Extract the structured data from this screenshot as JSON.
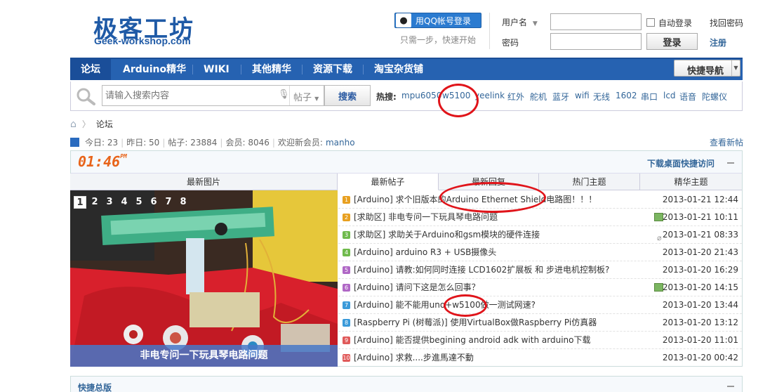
{
  "header": {
    "logo_cn": "极客工坊",
    "logo_en": "Geek-workshop.com",
    "qq_login": "用QQ帐号登录",
    "qq_tip": "只需一步，快速开始",
    "username_label": "用户名",
    "password_label": "密码",
    "auto_login": "自动登录",
    "login_button": "登录",
    "find_password": "找回密码",
    "register": "注册"
  },
  "nav": {
    "items": [
      "论坛",
      "Arduino精华",
      "WIKI",
      "其他精华",
      "资源下载",
      "淘宝杂货铺"
    ],
    "quick_nav": "快捷导航"
  },
  "search": {
    "placeholder": "请输入搜索内容",
    "type": "帖子",
    "button": "搜索",
    "hot_label": "热搜:",
    "hot_words": [
      "mpu6050",
      "w5100",
      "yeelink",
      "红外",
      "舵机",
      "蓝牙",
      "wifi",
      "无线",
      "1602",
      "串口",
      "lcd",
      "语音",
      "陀螺仪"
    ]
  },
  "breadcrumb": {
    "current": "论坛"
  },
  "stats": {
    "today": "今日: 23",
    "yesterday": "昨日: 50",
    "posts": "帖子: 23884",
    "members": "会员: 8046",
    "welcome_label": "欢迎新会员:",
    "new_member": "manho",
    "view_new": "查看新帖"
  },
  "panel": {
    "clock": "01:46",
    "clock_suffix": "PM",
    "download_link": "下载桌面快捷访问",
    "tabs": [
      "最新图片",
      "最新帖子",
      "最新回复",
      "热门主题",
      "精华主题"
    ],
    "pager": [
      "1",
      "2",
      "3",
      "4",
      "5",
      "6",
      "7",
      "8"
    ],
    "photo_caption": "非电专问一下玩具琴电路问题"
  },
  "posts": [
    {
      "num": "1",
      "title": "[Arduino] 求个旧版本的Arduino Ethernet Shield电路图！！！",
      "date": "2013-01-21 12:44",
      "icon": ""
    },
    {
      "num": "2",
      "title": "[求助区] 非电专问一下玩具琴电路问题",
      "date": "2013-01-21 10:11",
      "icon": "image-icon"
    },
    {
      "num": "3",
      "title": "[求助区] 求助关于Arduino和gsm模块的硬件连接",
      "date": "2013-01-21 08:33",
      "icon": "attachment-icon"
    },
    {
      "num": "4",
      "title": "[Arduino] arduino R3 + USB摄像头",
      "date": "2013-01-20 21:43",
      "icon": ""
    },
    {
      "num": "5",
      "title": "[Arduino] 请教:如何同时连接 LCD1602扩展板 和 步进电机控制板?",
      "date": "2013-01-20 16:29",
      "icon": ""
    },
    {
      "num": "6",
      "title": "[Arduino] 请问下这是怎么回事？",
      "date": "2013-01-20 14:15",
      "icon": "image-icon"
    },
    {
      "num": "7",
      "title": "[Arduino] 能不能用uno+w5100做一测试网速?",
      "date": "2013-01-20 13:44",
      "icon": ""
    },
    {
      "num": "8",
      "title": "[Raspberry Pi (树莓派)] 使用VirtualBox做Raspberry Pi仿真器",
      "date": "2013-01-20 13:12",
      "icon": ""
    },
    {
      "num": "9",
      "title": "[Arduino] 能否提供begining android adk with arduino下载",
      "date": "2013-01-20 11:01",
      "icon": ""
    },
    {
      "num": "10",
      "title": "[Arduino] 求救....步進馬達不動",
      "date": "2013-01-20 00:42",
      "icon": ""
    }
  ],
  "bottom": {
    "title": "快捷总版"
  },
  "colors": {
    "brand": "#1f5aa6",
    "nav": "#2662b1",
    "annotation": "#e0141a",
    "clock": "#e8641a"
  }
}
